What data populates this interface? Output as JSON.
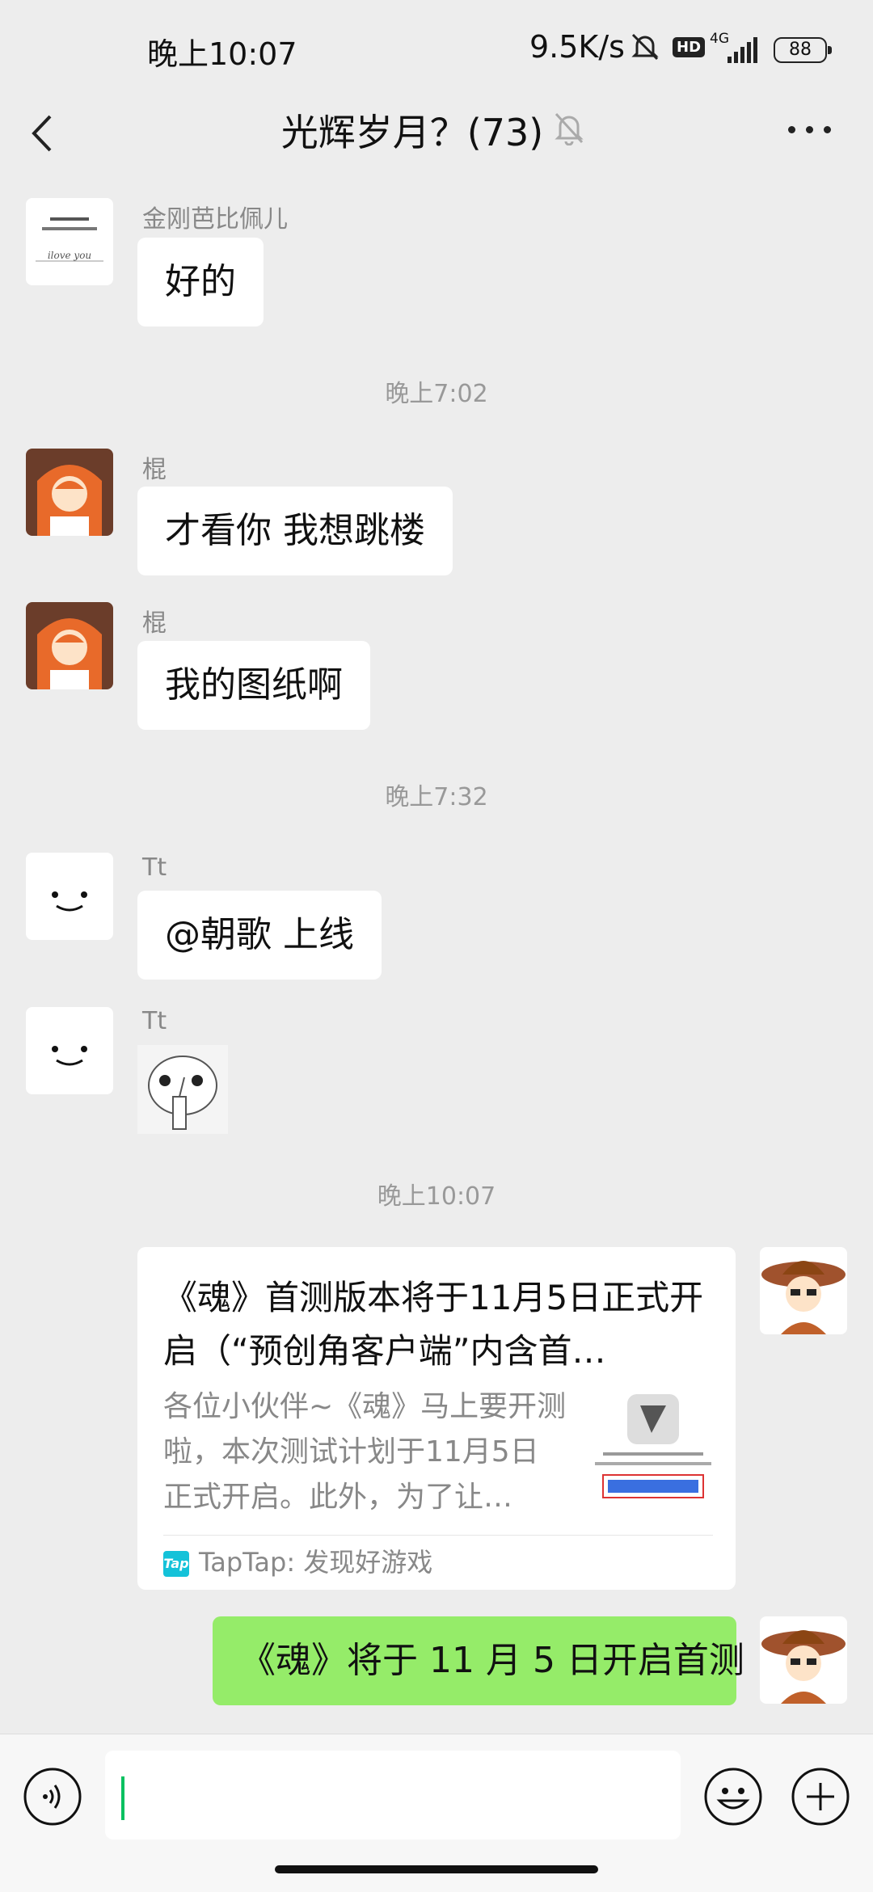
{
  "status_bar": {
    "time": "晚上10:07",
    "speed": "9.5K/s",
    "hd": "HD",
    "network": "4G",
    "battery": "88"
  },
  "header": {
    "title": "光辉岁月？(73)"
  },
  "messages": [
    {
      "sender": "金刚芭比佩儿",
      "text": "好的",
      "avatar_caption": "ilove you"
    },
    {
      "time": "晚上7:02"
    },
    {
      "sender": "棍",
      "text": "才看你 我想跳楼"
    },
    {
      "sender": "棍",
      "text": "我的图纸啊"
    },
    {
      "time": "晚上7:32"
    },
    {
      "sender": "Tt",
      "text": "@朝歌  上线"
    },
    {
      "sender": "Tt",
      "sticker": "sticker"
    },
    {
      "time": "晚上10:07"
    },
    {
      "card": {
        "title": "《魂》首测版本将于11月5日正式开启（“预创角客户端”内含首…",
        "desc": "各位小伙伴~《魂》马上要开测啦，本次测试计划于11月5日正式开启。此外，为了让…",
        "source": "TapTap: 发现好游戏",
        "badge": "Tap"
      }
    },
    {
      "mine": true,
      "text": "《魂》将于 11 月 5 日开启首测"
    }
  ],
  "input": {
    "value": ""
  },
  "colors": {
    "bg": "#ededed",
    "mine_bubble": "#95ec69",
    "cursor": "#07c160"
  }
}
